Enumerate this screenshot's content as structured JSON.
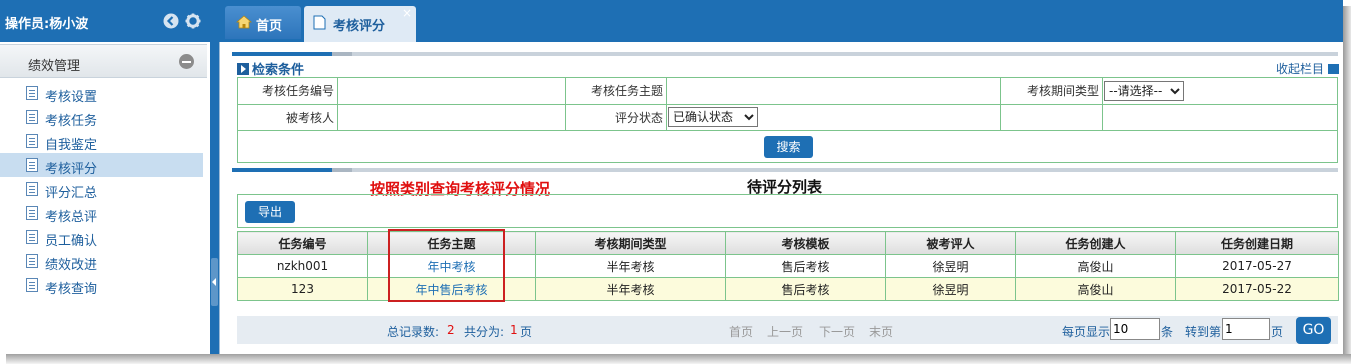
{
  "sidebar": {
    "operator": "操作员:杨小波",
    "group": "绩效管理",
    "items": [
      {
        "label": "考核设置"
      },
      {
        "label": "考核任务"
      },
      {
        "label": "自我鉴定"
      },
      {
        "label": "考核评分"
      },
      {
        "label": "评分汇总"
      },
      {
        "label": "考核总评"
      },
      {
        "label": "员工确认"
      },
      {
        "label": "绩效改进"
      },
      {
        "label": "考核查询"
      }
    ],
    "active_index": 3
  },
  "tabs": [
    {
      "label": "首页"
    },
    {
      "label": "考核评分",
      "close": "×"
    }
  ],
  "search": {
    "title": "检索条件",
    "collapse": "收起栏目",
    "task_no_label": "考核任务编号",
    "task_no_value": "",
    "task_theme_label": "考核任务主题",
    "task_theme_value": "",
    "period_type_label": "考核期间类型",
    "period_type_value": "--请选择--",
    "assessee_label": "被考核人",
    "assessee_value": "",
    "score_status_label": "评分状态",
    "score_status_value": "已确认状态",
    "search_button": "搜索"
  },
  "annotation": "按照类别查询考核评分情况",
  "list_title": "待评分列表",
  "export_button": "导出",
  "table": {
    "headers": [
      "任务编号",
      "任务主题",
      "考核期间类型",
      "考核模板",
      "被考评人",
      "任务创建人",
      "任务创建日期"
    ],
    "rows": [
      [
        "nzkh001",
        "年中考核",
        "半年考核",
        "售后考核",
        "徐昱明",
        "高俊山",
        "2017-05-27"
      ],
      [
        "123",
        "年中售后考核",
        "半年考核",
        "售后考核",
        "徐昱明",
        "高俊山",
        "2017-05-22"
      ]
    ]
  },
  "pager": {
    "total_label": "总记录数:",
    "total": "2",
    "pages_label": "共分为:",
    "pages": "1",
    "pages_unit": "页",
    "first": "首页",
    "prev": "上一页",
    "next": "下一页",
    "last": "末页",
    "per_page_label": "每页显示",
    "per_page": "10",
    "per_page_unit": "条",
    "goto_label": "转到第",
    "goto_page": "1",
    "goto_unit": "页",
    "go_button": "GO"
  },
  "colors": {
    "primary": "#1e6fb4",
    "border_green": "#7cc48c",
    "annotation_red": "#e01010",
    "row_highlight": "#fcfbdc"
  },
  "icons": {
    "back": "circle-arrow-left-icon",
    "settings": "gear-icon",
    "home": "home-icon",
    "tab_doc": "document-icon"
  }
}
